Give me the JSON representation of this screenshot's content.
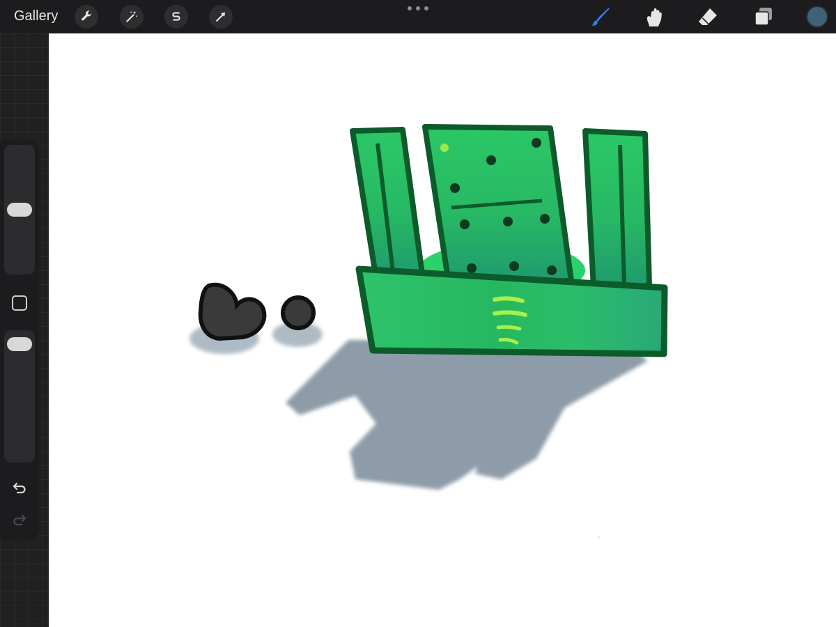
{
  "toolbar": {
    "gallery_label": "Gallery",
    "left_tools": [
      "wrench-icon",
      "magic-wand-icon",
      "selection-s-icon",
      "arrow-transform-icon"
    ],
    "right_tools": [
      "brush-icon",
      "smudge-icon",
      "eraser-icon",
      "layers-icon"
    ],
    "active_tool": "brush-icon"
  },
  "colors": {
    "toolbar_bg": "#1c1c1e",
    "active_brush": "#2d7ff9",
    "current_color": "#3f6277",
    "canvas_bg": "#ffffff",
    "drawing_green": "#27c266",
    "drawing_outline": "#0c5b2b",
    "shadow": "#8a9aa6"
  },
  "sidebar": {
    "brush_size_level": 0.5,
    "opacity_level": 0.04,
    "undo": "undo-icon",
    "redo": "redo-icon",
    "redo_enabled": false
  }
}
